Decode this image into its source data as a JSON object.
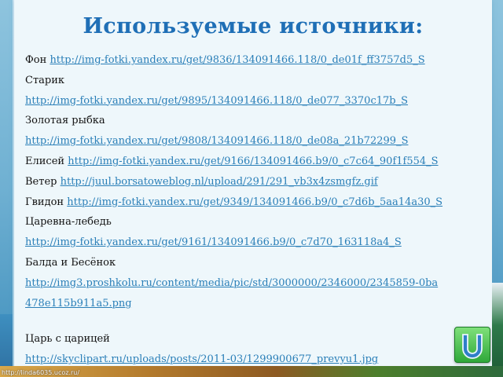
{
  "title": "Используемые источники:",
  "sources": [
    {
      "label": "Фон",
      "url": "http://img-fotki.yandex.ru/get/9836/134091466.118/0_de01f_ff3757d5_S"
    },
    {
      "label": "Старик",
      "url": ""
    },
    {
      "label": "",
      "url": "http://img-fotki.yandex.ru/get/9895/134091466.118/0_de077_3370c17b_S"
    },
    {
      "label": "Золотая рыбка",
      "url": ""
    },
    {
      "label": "",
      "url": "http://img-fotki.yandex.ru/get/9808/134091466.118/0_de08a_21b72299_S"
    },
    {
      "label": "Елисей",
      "url": "http://img-fotki.yandex.ru/get/9166/134091466.b9/0_c7c64_90f1f554_S"
    },
    {
      "label": "Ветер",
      "url": "http://juul.borsatoweblog.nl/upload/291/291_vb3x4zsmgfz.gif"
    },
    {
      "label": "Гвидон",
      "url": "http://img-fotki.yandex.ru/get/9349/134091466.b9/0_c7d6b_5aa14a30_S"
    },
    {
      "label": "Царевна-лебедь",
      "url": ""
    },
    {
      "label": "",
      "url": "http://img-fotki.yandex.ru/get/9161/134091466.b9/0_c7d70_163118a4_S"
    },
    {
      "label": "Балда и Бесёнок",
      "url": ""
    },
    {
      "label": "",
      "url": "http://img3.proshkolu.ru/content/media/pic/std/3000000/2346000/2345859-0ba"
    },
    {
      "label": "",
      "url": "478e115b911a5.png"
    },
    {
      "label": "",
      "url": ""
    },
    {
      "label": "Царь с царицей",
      "url": ""
    },
    {
      "label": "",
      "url": "http://skyclipart.ru/uploads/posts/2011-03/1299900677_prevyu1.jpg"
    }
  ],
  "footer_url": "http://linda6035.ucoz.ru/",
  "icons": {
    "back": "back-arrow-icon"
  },
  "colors": {
    "title": "#1f6fb6",
    "link": "#2a7fb8",
    "button": "#2fa83a"
  }
}
